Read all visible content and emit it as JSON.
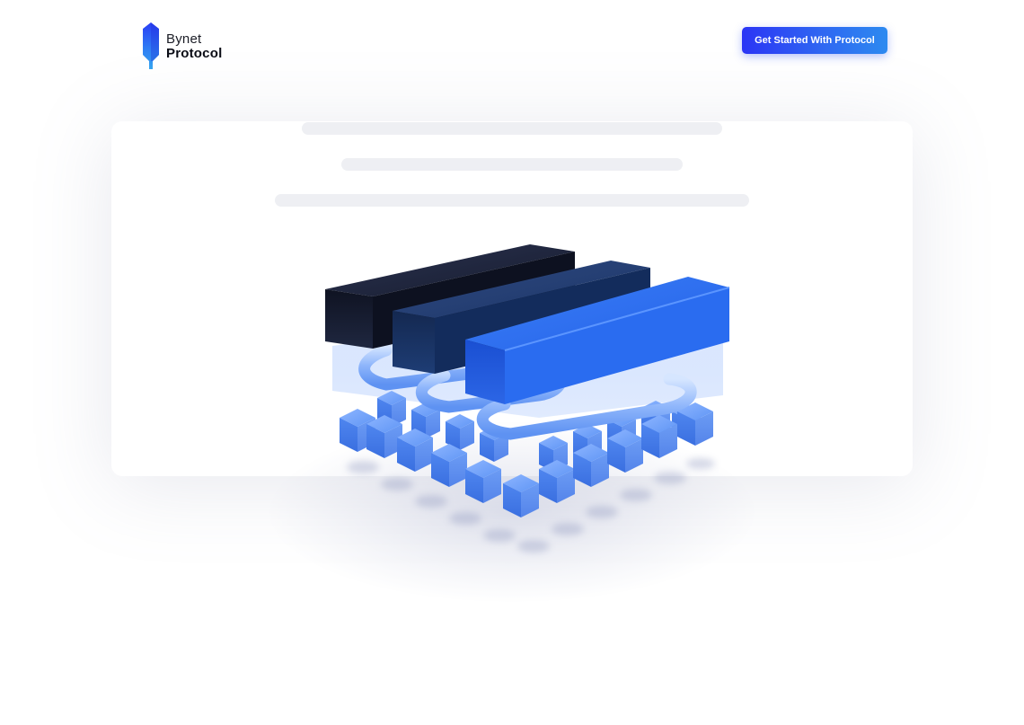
{
  "header": {
    "logo": {
      "line1": "Bynet",
      "line2": "Protocol",
      "icon": "crystal-logo-icon"
    },
    "cta_label": "Get Started With Protocol"
  },
  "colors": {
    "brand_blue": "#2f67f2",
    "cta_start": "#2b35f5",
    "cta_end": "#2d8af0",
    "skeleton": "#eeeff3",
    "dark_block": "#141a2e",
    "mid_block": "#1b3668",
    "bright_block": "#2563e8",
    "cube": "#4a86f0"
  },
  "illustration": {
    "icon": "modular-blockchain-layers-illustration"
  }
}
